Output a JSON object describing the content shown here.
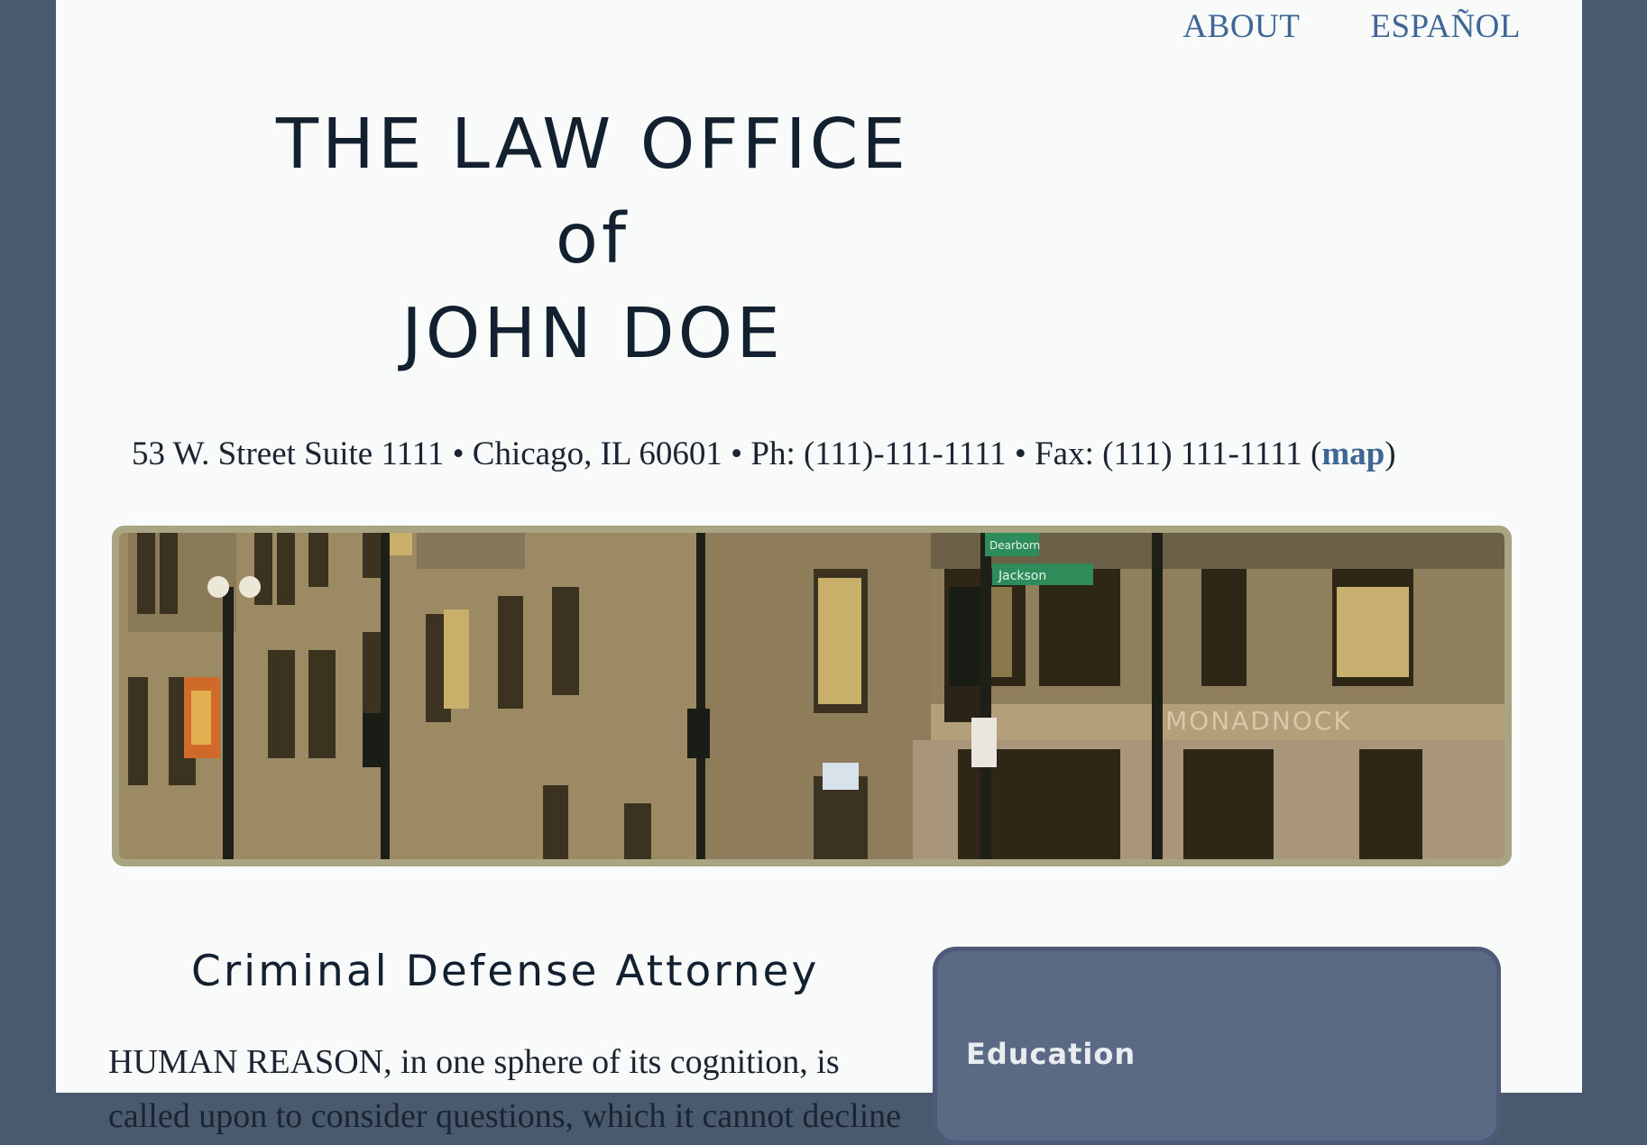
{
  "nav": {
    "about": "ABOUT",
    "espanol": "ESPAÑOL"
  },
  "header": {
    "title_line1": "THE LAW OFFICE",
    "title_line2": "of",
    "title_line3": "JOHN DOE"
  },
  "contact": {
    "address_text": "53 W. Street Suite 1111 • Chicago, IL 60601 • Ph: (111)-111-1111 • Fax: (111) 111-1111 (",
    "map_label": "map",
    "close_paren": ")"
  },
  "hero": {
    "sign_dearborn": "Dearborn",
    "sign_jackson": "Jackson",
    "building_lettering": "MONADNOCK"
  },
  "main": {
    "heading": "Criminal Defense Attorney",
    "intro": "HUMAN REASON, in one sphere of its cognition, is called upon to consider questions, which it cannot decline"
  },
  "sidebar": {
    "card_title": "Education"
  },
  "colors": {
    "outer_bg": "#4a5a6e",
    "page_bg": "#f9fafa",
    "link": "#3e6795",
    "title": "#12202f",
    "card_bg": "#5a6a85",
    "hero_border": "#a9a583"
  }
}
